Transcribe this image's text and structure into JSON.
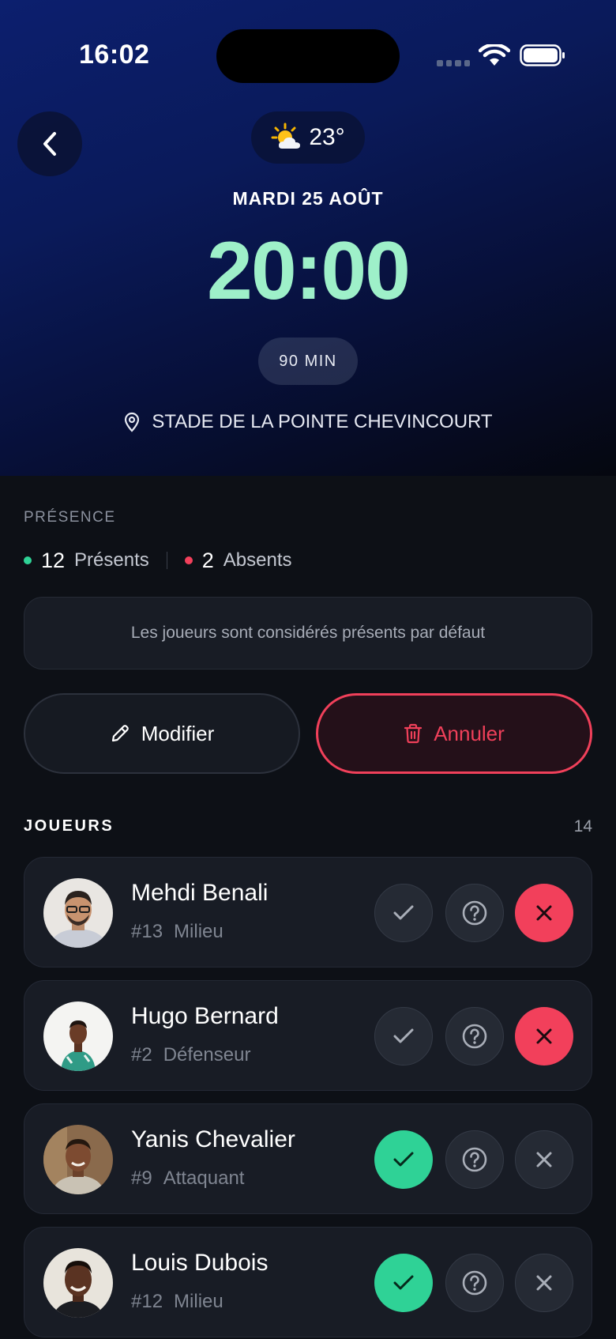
{
  "status_bar": {
    "time": "16:02"
  },
  "header": {
    "weather_icon": "sun-behind-cloud-icon",
    "temperature": "23°",
    "date": "MARDI 25 AOÛT",
    "time": "20:00",
    "duration": "90 MIN",
    "location": "STADE DE LA POINTE CHEVINCOURT"
  },
  "presence": {
    "title": "PRÉSENCE",
    "present_count": "12",
    "present_label": "Présents",
    "absent_count": "2",
    "absent_label": "Absents",
    "info": "Les joueurs sont considérés présents par défaut",
    "colors": {
      "present": "#2fd296",
      "absent": "#f2405b"
    }
  },
  "actions": {
    "edit_label": "Modifier",
    "cancel_label": "Annuler"
  },
  "players": {
    "title": "JOUEURS",
    "count": "14",
    "list": [
      {
        "name": "Mehdi Benali",
        "number": "#13",
        "position": "Milieu",
        "status": "absent"
      },
      {
        "name": "Hugo Bernard",
        "number": "#2",
        "position": "Défenseur",
        "status": "absent"
      },
      {
        "name": "Yanis Chevalier",
        "number": "#9",
        "position": "Attaquant",
        "status": "present"
      },
      {
        "name": "Louis Dubois",
        "number": "#12",
        "position": "Milieu",
        "status": "present"
      }
    ]
  }
}
